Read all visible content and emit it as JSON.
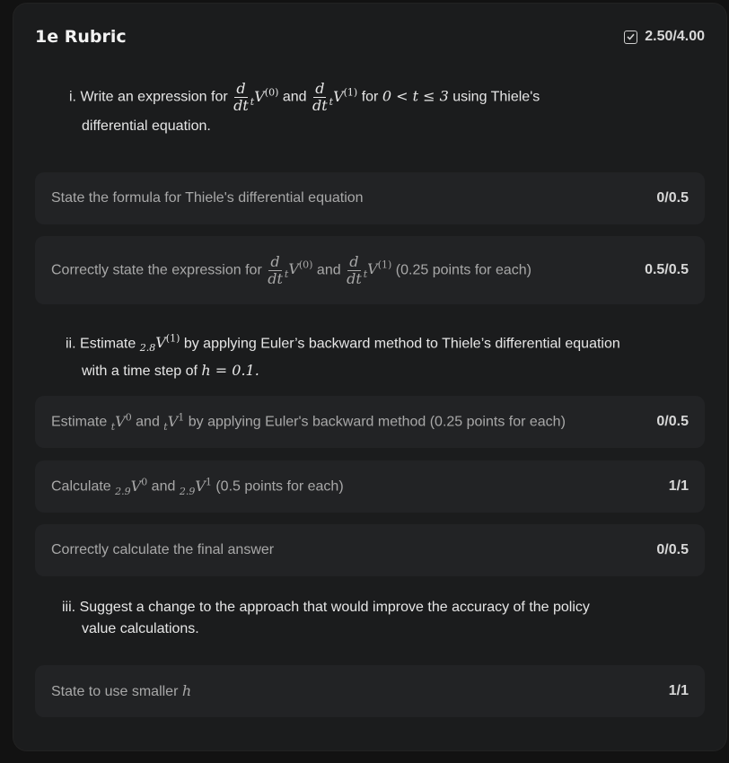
{
  "header": {
    "title": "1e Rubric",
    "total_score": "2.50/4.00"
  },
  "questions": [
    {
      "num": "i.",
      "text_1": "Write an expression for",
      "and": "and",
      "text_2": "for",
      "range": "0 < t ≤ 3",
      "text_3": "using Thiele's",
      "text_4": "differential equation."
    },
    {
      "num": "ii.",
      "text_1": "Estimate",
      "text_2": "by applying Euler’s backward method to Thiele’s differential equation",
      "text_3": "with a time step of",
      "math_h": "h = 0.1."
    },
    {
      "num": "iii.",
      "text_1": "Suggest a change to the approach that would improve the accuracy of the policy",
      "text_2": "value calculations."
    }
  ],
  "criteria": [
    {
      "text": "State the formula for Thiele's differential equation",
      "score": "0/0.5"
    },
    {
      "text_1": "Correctly state the expression for",
      "and": "and",
      "text_2": "(0.25 points for each)",
      "score": "0.5/0.5"
    },
    {
      "text_1": "Estimate",
      "and": "and",
      "text_2": "by applying Euler's backward method (0.25 points for each)",
      "score": "0/0.5"
    },
    {
      "text_1": "Calculate",
      "and": "and",
      "text_2": "(0.5 points for each)",
      "score": "1/1"
    },
    {
      "text": "Correctly calculate the final answer",
      "score": "0/0.5"
    },
    {
      "text_1": "State to use smaller",
      "math": "h",
      "score": "1/1"
    }
  ],
  "icons": {
    "score_icon": "checkbox-check-icon"
  }
}
